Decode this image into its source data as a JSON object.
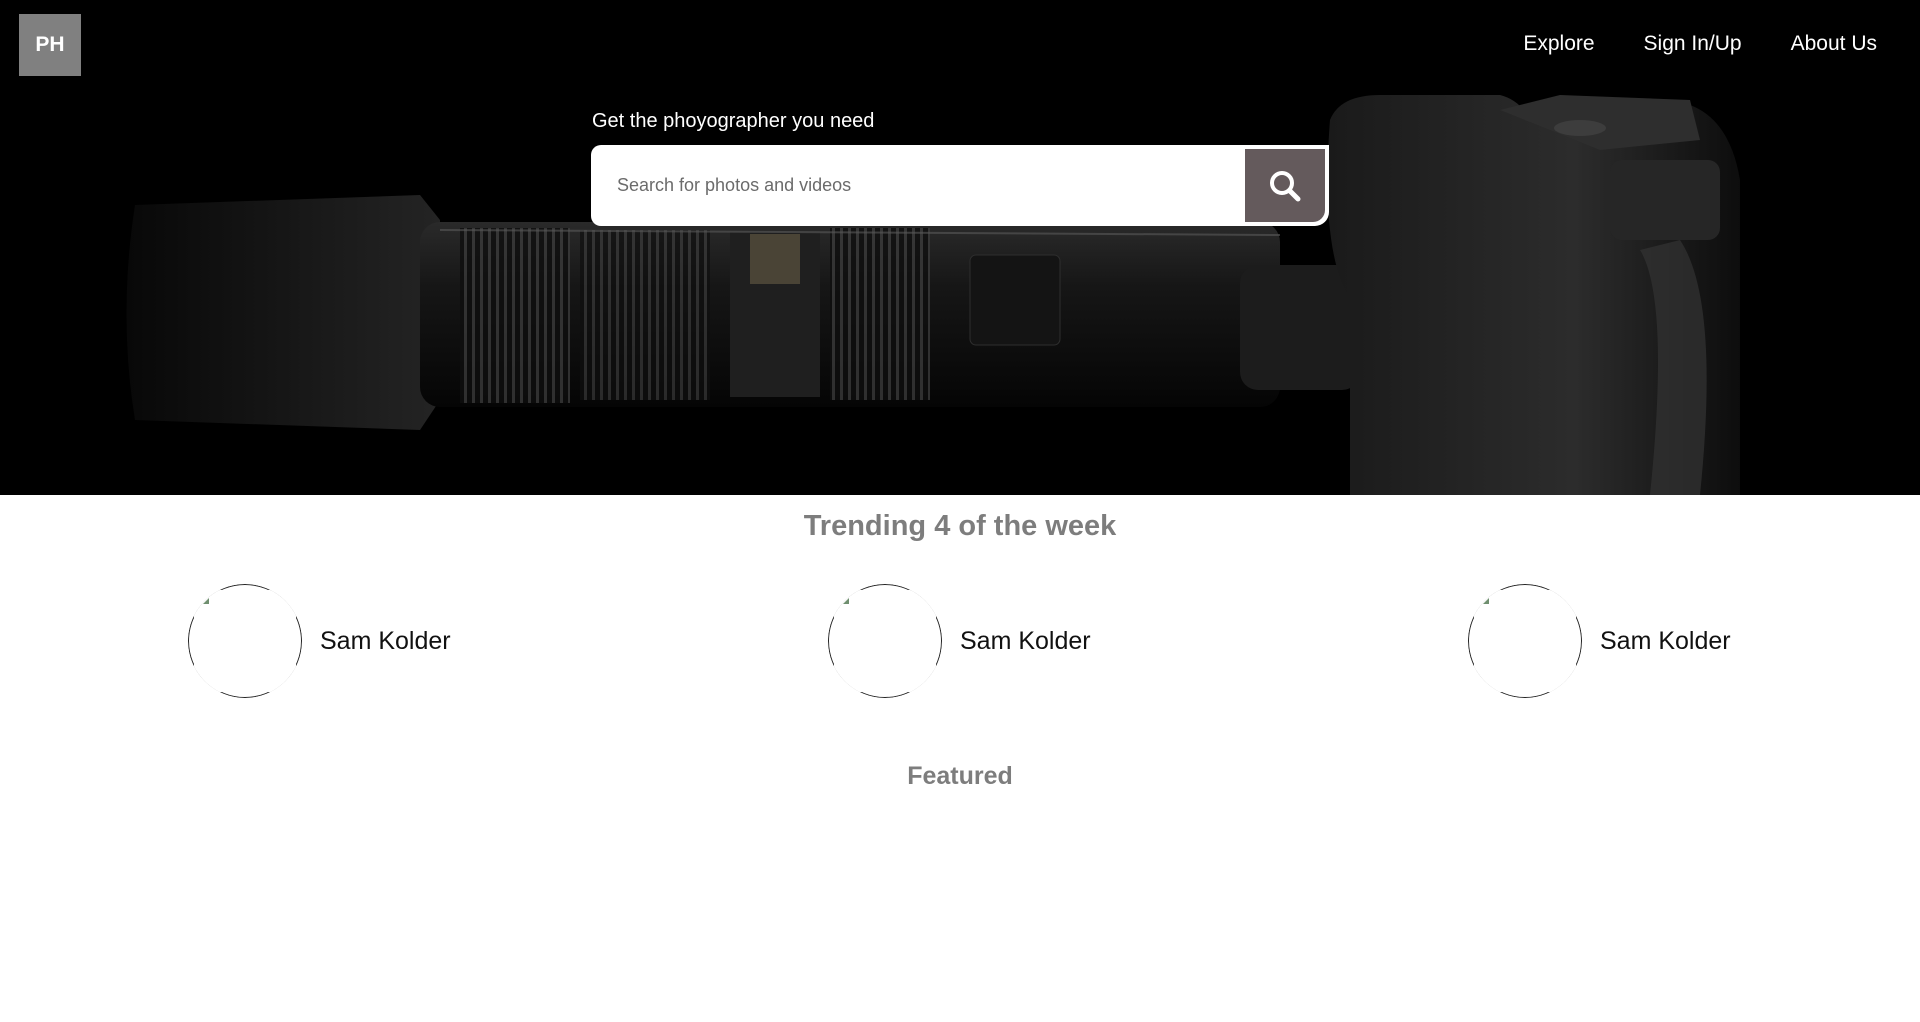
{
  "brand": {
    "logo_text": "PH"
  },
  "nav": {
    "items": [
      {
        "label": "Explore"
      },
      {
        "label": "Sign In/Up"
      },
      {
        "label": "About Us"
      }
    ]
  },
  "hero": {
    "caption": "Get the phoyographer you need",
    "search": {
      "placeholder": "Search for photos and videos",
      "value": "",
      "button_icon": "search-icon"
    }
  },
  "trending": {
    "title": "Trending 4 of the week",
    "photographers": [
      {
        "name": "Sam Kolder"
      },
      {
        "name": "Sam Kolder"
      },
      {
        "name": "Sam Kolder"
      }
    ]
  },
  "featured": {
    "title": "Featured"
  },
  "colors": {
    "hero_background": "#000000",
    "logo_background": "#808080",
    "search_button": "#645a5c",
    "section_title": "#7d7d7d"
  }
}
